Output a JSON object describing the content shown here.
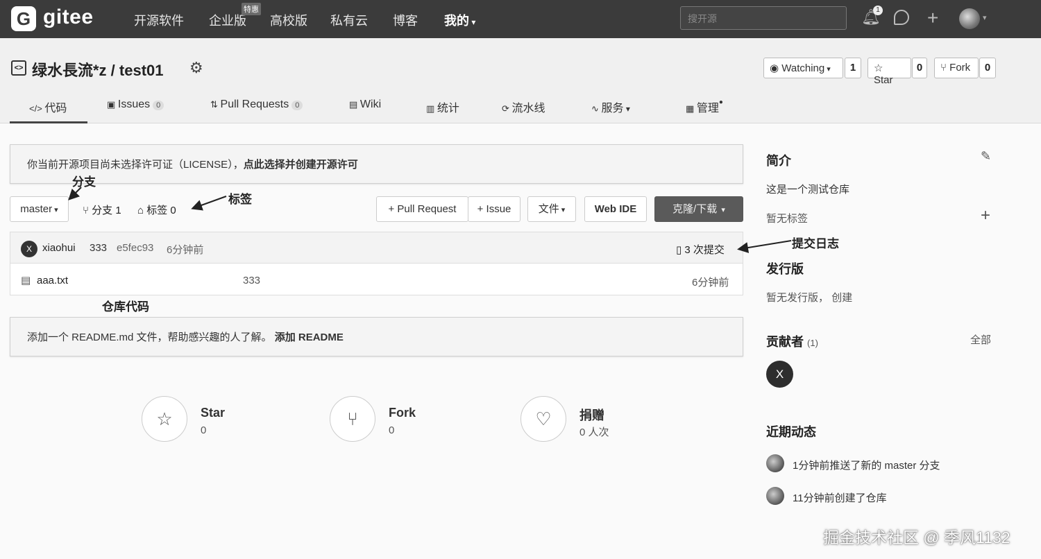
{
  "nav": {
    "logo_glyph": "G",
    "logo_text": "gitee",
    "items": [
      "开源软件",
      "企业版",
      "高校版",
      "私有云",
      "博客",
      "我的"
    ],
    "enterprise_badge": "特惠",
    "search_placeholder": "搜开源",
    "notification_count": "1"
  },
  "repo": {
    "title": "绿水長流*z / test01",
    "watching_label": "Watching",
    "watching_count": "1",
    "star_label": "Star",
    "star_count": "0",
    "fork_label": "Fork",
    "fork_count": "0"
  },
  "tabs": [
    {
      "label": "代码"
    },
    {
      "label": "Issues",
      "count": "0"
    },
    {
      "label": "Pull Requests",
      "count": "0"
    },
    {
      "label": "Wiki"
    },
    {
      "label": "统计"
    },
    {
      "label": "流水线"
    },
    {
      "label": "服务"
    },
    {
      "label": "管理"
    }
  ],
  "license_notice": {
    "text": "你当前开源项目尚未选择许可证（LICENSE），",
    "link": "点此选择并创建开源许可"
  },
  "toolbar": {
    "branch": "master",
    "branches": "分支 1",
    "tags": "标签 0",
    "pull_request": "+ Pull Request",
    "issue": "+ Issue",
    "file": "文件",
    "web_ide": "Web IDE",
    "clone": "克隆/下载"
  },
  "commit": {
    "avatar_letter": "X",
    "author": "xiaohui",
    "message": "333",
    "hash": "e5fec93",
    "time": "6分钟前",
    "count_label": "3 次提交"
  },
  "files": [
    {
      "name": "aaa.txt",
      "message": "333",
      "time": "6分钟前"
    }
  ],
  "readme_notice": {
    "text": "添加一个 README.md 文件，帮助感兴趣的人了解。",
    "link": "添加 README"
  },
  "annotations": {
    "branch": "分支",
    "tag": "标签",
    "commit_log": "提交日志",
    "repo_code": "仓库代码"
  },
  "stats": [
    {
      "label": "Star",
      "value": "0",
      "icon": "star-icon"
    },
    {
      "label": "Fork",
      "value": "0",
      "icon": "fork-icon"
    },
    {
      "label": "捐赠",
      "value": "0 人次",
      "icon": "donate-icon"
    }
  ],
  "sidebar": {
    "intro_heading": "简介",
    "description": "这是一个测试仓库",
    "no_tags": "暂无标签",
    "release_heading": "发行版",
    "no_release": "暂无发行版，",
    "create": "创建",
    "contributors_heading": "贡献者",
    "contributors_count": "(1)",
    "all": "全部",
    "contributor_letter": "X",
    "activity_heading": "近期动态",
    "activities": [
      "1分钟前推送了新的 master 分支",
      "11分钟前创建了仓库"
    ]
  },
  "watermark": "掘金技术社区 @ 季风1132"
}
